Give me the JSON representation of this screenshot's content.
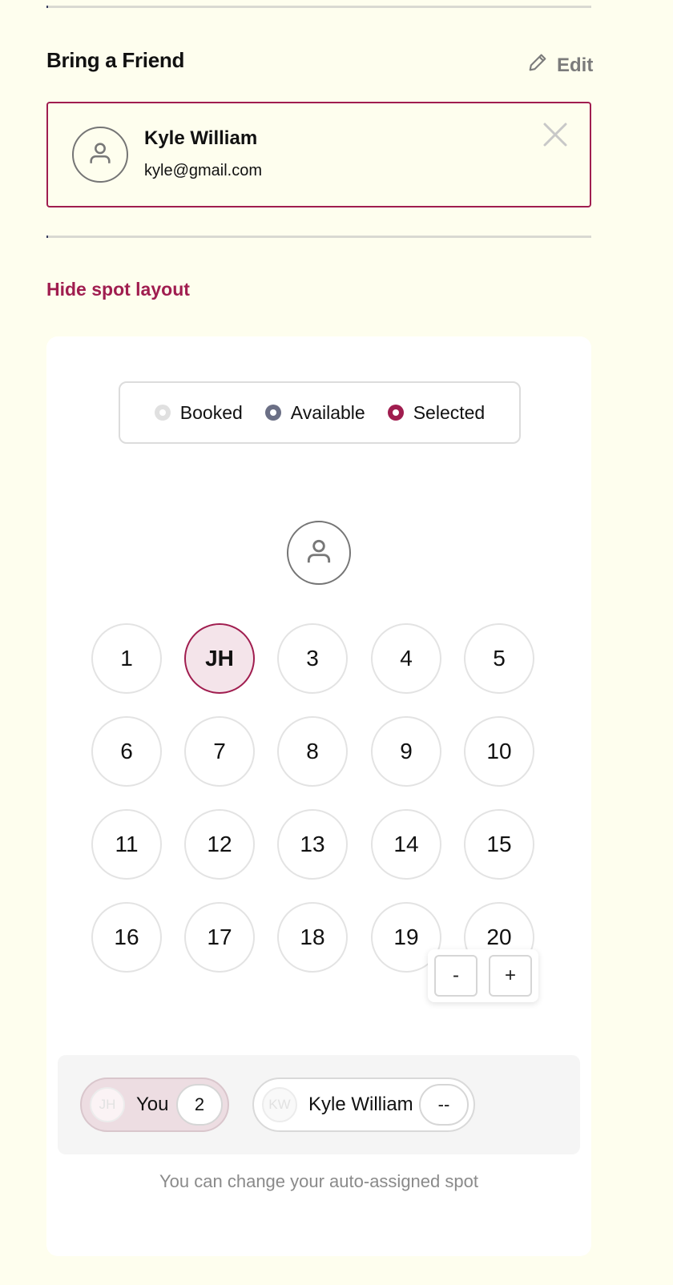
{
  "friend_section": {
    "title": "Bring a Friend",
    "edit_label": "Edit",
    "friend": {
      "name": "Kyle William",
      "email": "kyle@gmail.com"
    }
  },
  "layout_toggle_label": "Hide spot layout",
  "legend": [
    {
      "label": "Booked",
      "color": "#e0e0e0"
    },
    {
      "label": "Available",
      "color": "#6b6f85"
    },
    {
      "label": "Selected",
      "color": "#a01d4f"
    }
  ],
  "spots": [
    "1",
    "JH",
    "3",
    "4",
    "5",
    "6",
    "7",
    "8",
    "9",
    "10",
    "11",
    "12",
    "13",
    "14",
    "15",
    "16",
    "17",
    "18",
    "19",
    "20"
  ],
  "selected_spot_index": 1,
  "zoom": {
    "minus": "-",
    "plus": "+"
  },
  "attendees": [
    {
      "initials": "JH",
      "name": "You",
      "spot": "2"
    },
    {
      "initials": "KW",
      "name": "Kyle William",
      "spot": "--"
    }
  ],
  "hint": "You can change your auto-assigned spot",
  "colors": {
    "accent": "#a01d4f",
    "background": "#fefeee"
  }
}
